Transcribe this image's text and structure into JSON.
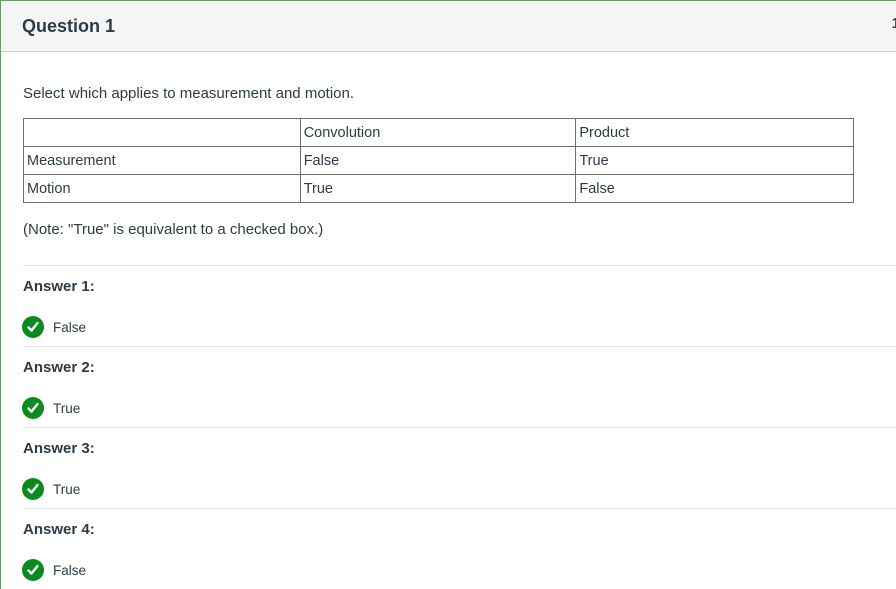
{
  "question": {
    "title": "Question 1",
    "points": "1",
    "text": "Select which applies to measurement and motion.",
    "note": "(Note: \"True\" is equivalent to a checked box.)"
  },
  "table": {
    "headers": [
      "",
      "Convolution",
      "Product"
    ],
    "rows": [
      [
        "Measurement",
        "False",
        "True"
      ],
      [
        "Motion",
        "True",
        "False"
      ]
    ]
  },
  "answers": [
    {
      "label": "Answer 1:",
      "value": "False"
    },
    {
      "label": "Answer 2:",
      "value": "True"
    },
    {
      "label": "Answer 3:",
      "value": "True"
    },
    {
      "label": "Answer 4:",
      "value": "False"
    }
  ],
  "colors": {
    "correct": "#0b8a1f",
    "header_bg": "#f5f5f5",
    "text": "#2d3b45"
  },
  "icons": {
    "correct": "check-circle-icon"
  }
}
